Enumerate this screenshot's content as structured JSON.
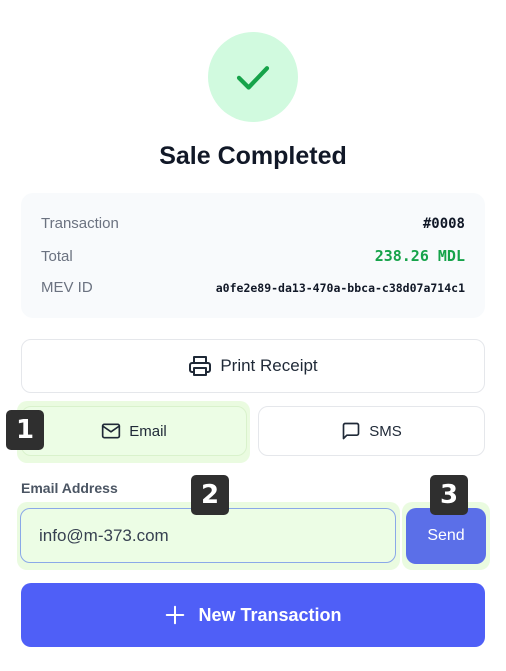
{
  "status": {
    "icon": "check-icon",
    "title": "Sale Completed"
  },
  "summary": {
    "transaction_label": "Transaction",
    "transaction_value": "#0008",
    "total_label": "Total",
    "total_value": "238.26 MDL",
    "mev_label": "MEV ID",
    "mev_value": "a0fe2e89-da13-470a-bbca-c38d07a714c1"
  },
  "actions": {
    "print_label": "Print Receipt",
    "print_icon": "printer-icon",
    "email_label": "Email",
    "email_icon": "mail-icon",
    "sms_label": "SMS",
    "sms_icon": "message-icon"
  },
  "email_form": {
    "label": "Email Address",
    "value": "info@m-373.com",
    "send_label": "Send"
  },
  "new_transaction": {
    "label": "New Transaction",
    "icon": "plus-icon"
  },
  "annotations": [
    "1",
    "2",
    "3"
  ],
  "colors": {
    "success": "#16a34a",
    "primary": "#4f5ff7",
    "send": "#5b6fe8",
    "highlight": "#eafbe0"
  }
}
